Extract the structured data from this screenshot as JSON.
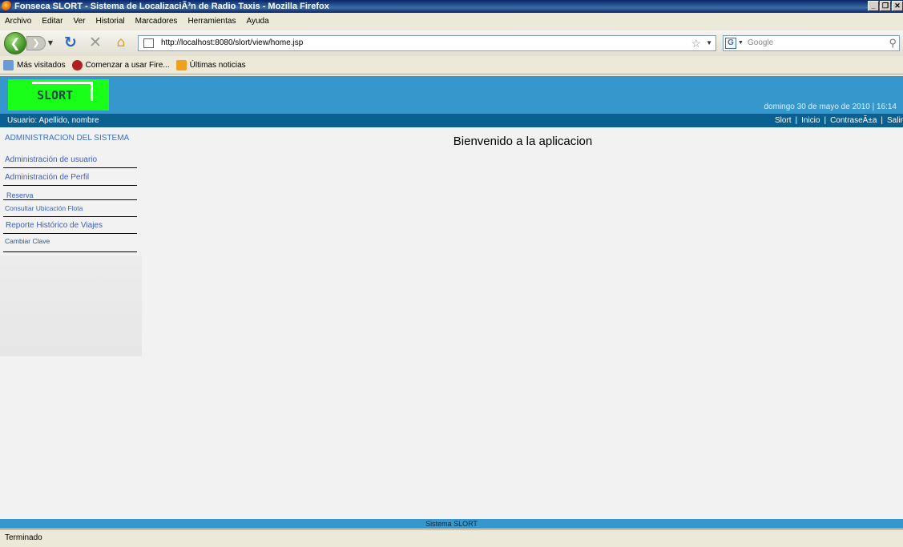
{
  "window": {
    "title": "Fonseca SLORT - Sistema de LocalizaciÃ³n de Radio Taxis - Mozilla Firefox",
    "buttons": [
      "_",
      "❐",
      "✕"
    ]
  },
  "menu": {
    "items": [
      "Archivo",
      "Editar",
      "Ver",
      "Historial",
      "Marcadores",
      "Herramientas",
      "Ayuda"
    ]
  },
  "navbar": {
    "url": "http://localhost:8080/slort/view/home.jsp",
    "search_placeholder": "Google",
    "icons": [
      "back-arrow-icon",
      "forward-arrow-icon",
      "reload-icon",
      "stop-icon",
      "home-icon",
      "star-icon",
      "search-icon"
    ]
  },
  "bookmarks": {
    "items": [
      "Más visitados",
      "Comenzar a usar Fire...",
      "Últimas noticias"
    ]
  },
  "app": {
    "logo_text": "SLORT",
    "datetime": "domingo 30 de mayo de 2010 | 16:14",
    "user_label": "Usuario: Apellido, nombre",
    "top_links": [
      "Slort",
      "Inicio",
      "ContraseÃ±a",
      "Salir"
    ],
    "sidebar_title": "ADMINISTRACION DEL SISTEMA",
    "sidebar_links": [
      "Administración de usuario",
      "Administración de Perfil",
      "Reserva",
      "Consultar Ubicación Flota",
      "Reporte Histórico de Viajes",
      "Cambiar Clave"
    ],
    "welcome": "Bienvenido a la aplicacion",
    "footer": "Sistema SLORT"
  },
  "status": {
    "text": "Terminado"
  },
  "colors": {
    "header_blue": "#3597cc",
    "userbar_blue": "#0a6090",
    "logo_green": "#1aff1a",
    "link_blue": "#3a5ec0"
  }
}
